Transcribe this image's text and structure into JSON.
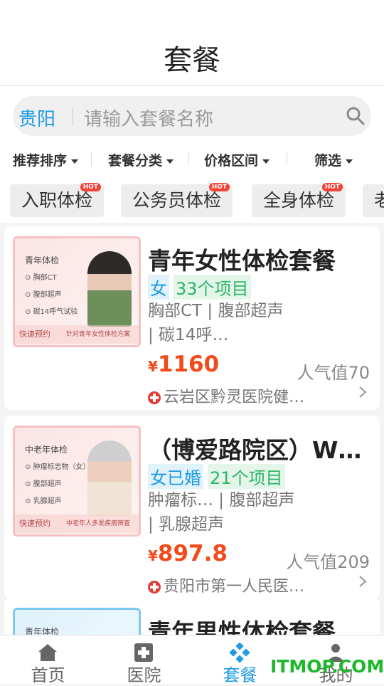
{
  "header": {
    "title": "套餐"
  },
  "search": {
    "city": "贵阳",
    "placeholder": "请输入套餐名称"
  },
  "filters": [
    "推荐排序",
    "套餐分类",
    "价格区间",
    "筛选"
  ],
  "chips": [
    {
      "label": "入职体检",
      "badge": "HOT"
    },
    {
      "label": "公务员体检",
      "badge": "HOT"
    },
    {
      "label": "全身体检",
      "badge": "HOT"
    },
    {
      "label": "老"
    }
  ],
  "packages": [
    {
      "name": "青年女性体检套餐",
      "gender": "女",
      "items_count": "33个项目",
      "items_line1": "胸部CT | 腹部超声",
      "items_line2": "| 碳14呼…",
      "currency": "¥",
      "price": "1160",
      "popularity": "人气值70",
      "hospital": "云岩区黔灵医院健…",
      "thumb": {
        "title": "青年体检",
        "rows": [
          "胸部CT",
          "腹部超声",
          "碳14呼气试验"
        ],
        "quick": "快速预约",
        "tag": "针对青年女性体检方案"
      }
    },
    {
      "name": "（博爱路院区）W…",
      "gender": "女已婚",
      "items_count": "21个项目",
      "items_line1": "肿瘤标… | 腹部超声",
      "items_line2": "| 乳腺超声",
      "currency": "¥",
      "price": "897.8",
      "popularity": "人气值209",
      "hospital": "贵阳市第一人民医…",
      "thumb": {
        "title": "中老年体检",
        "rows": [
          "肿瘤标志物（女）",
          "腹部超声",
          "乳腺超声"
        ],
        "quick": "快速预约",
        "tag": "中老年人多发疾病筛查"
      }
    },
    {
      "name": "青年男性体检套餐",
      "thumb": {
        "title": "青年体检"
      }
    }
  ],
  "tabbar": [
    {
      "label": "首页"
    },
    {
      "label": "医院"
    },
    {
      "label": "套餐"
    },
    {
      "label": "我的"
    }
  ],
  "watermark": "ITMOP.COM",
  "colors": {
    "accent": "#1d9be4",
    "price": "#f24a1b",
    "hot": "#f44336",
    "project_tag": "#2cb466"
  }
}
